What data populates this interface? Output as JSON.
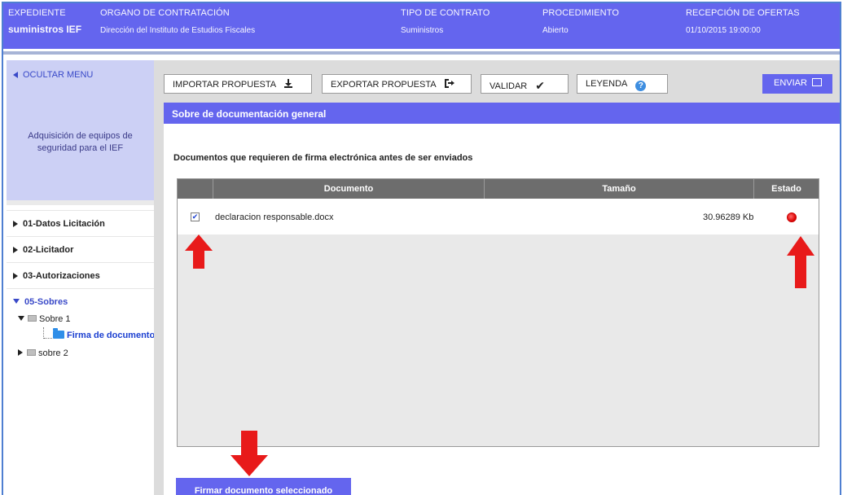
{
  "header": {
    "expediente": {
      "label": "EXPEDIENTE",
      "value": "suministros IEF"
    },
    "organo": {
      "label": "ORGANO DE CONTRATACIÓN",
      "value": "Dirección del Instituto de Estudios Fiscales"
    },
    "tipo": {
      "label": "TIPO DE CONTRATO",
      "value": "Suministros"
    },
    "procedimiento": {
      "label": "PROCEDIMIENTO",
      "value": "Abierto"
    },
    "recepcion": {
      "label": "RECEPCIÓN DE OFERTAS",
      "value": "01/10/2015 19:00:00"
    }
  },
  "sidebar": {
    "toggle_label": "OCULTAR MENU",
    "project_title": "Adquisición de equipos de seguridad para el IEF",
    "items": [
      {
        "label": "01-Datos Licitación"
      },
      {
        "label": "02-Licitador"
      },
      {
        "label": "03-Autorizaciones"
      },
      {
        "label": "05-Sobres"
      }
    ],
    "tree": {
      "sobre1": "Sobre 1",
      "firma": "Firma de documentos",
      "sobre2": "sobre 2"
    }
  },
  "toolbar": {
    "importar": "IMPORTAR PROPUESTA",
    "exportar": "EXPORTAR PROPUESTA",
    "validar": "VALIDAR",
    "leyenda": "LEYENDA",
    "enviar": "ENVIAR",
    "help_glyph": "?"
  },
  "panel": {
    "title": "Sobre de documentación general",
    "subtitle": "Documentos que requieren de firma electrónica antes de ser enviados",
    "columns": {
      "documento": "Documento",
      "tamano": "Tamaño",
      "estado": "Estado"
    },
    "rows": [
      {
        "checked": true,
        "check_glyph": "✔",
        "documento": "declaracion responsable.docx",
        "tamano": "30.96289 Kb"
      }
    ],
    "sign_button": "Firmar documento seleccionado"
  },
  "colors": {
    "brand": "#6465ee",
    "annotation": "#e81a1a",
    "status": "#e10d0d"
  }
}
